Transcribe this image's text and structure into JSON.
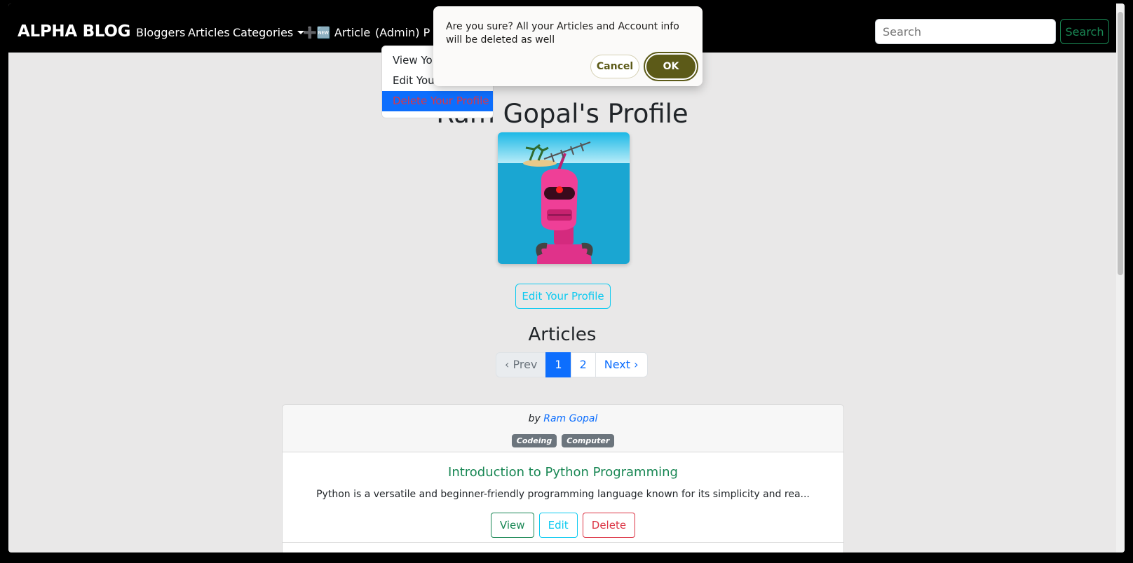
{
  "navbar": {
    "brand": "ALPHA BLOG",
    "links": [
      "Bloggers",
      "Articles",
      "Categories",
      "➕🆕 Article",
      "(Admin) P"
    ],
    "search_placeholder": "Search",
    "search_button": "Search"
  },
  "dropdown": {
    "items": [
      "View Your Profile",
      "Edit Your Profile",
      "Delete Your Profile"
    ],
    "active_index": 2
  },
  "confirm_dialog": {
    "message": "Are you sure? All your Articles and Account info will be deleted as well",
    "cancel": "Cancel",
    "ok": "OK"
  },
  "profile": {
    "title": "Ram Gopal's Profile",
    "edit_button": "Edit Your Profile"
  },
  "articles": {
    "heading": "Articles",
    "pagination": {
      "prev": "‹ Prev",
      "pages": [
        "1",
        "2"
      ],
      "current": "1",
      "next": "Next ›"
    },
    "items": [
      {
        "by_prefix": "by",
        "author": "Ram Gopal",
        "categories": [
          "Codeing",
          "Computer"
        ],
        "title": "Introduction to Python Programming",
        "excerpt": "Python is a versatile and beginner-friendly programming language known for its simplicity and rea...",
        "actions": {
          "view": "View",
          "edit": "Edit",
          "delete": "Delete"
        }
      }
    ]
  },
  "colors": {
    "primary": "#0d6efd",
    "success": "#198754",
    "info": "#0dcaf0",
    "danger": "#dc3545",
    "dialog_accent": "#5c5a18"
  }
}
